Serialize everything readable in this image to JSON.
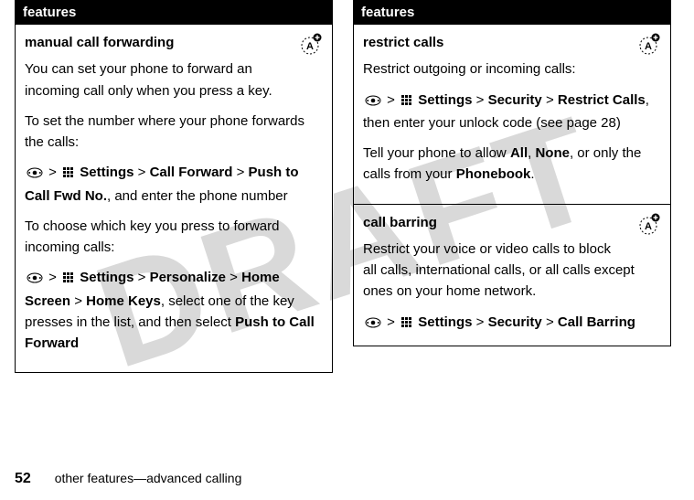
{
  "watermark": "DRAFT",
  "left": {
    "header": "features",
    "section": {
      "title": "manual call forwarding",
      "p1": "You can set your phone to forward an incoming call only when you press a key.",
      "p2": "To set the number where your phone forwards the calls:",
      "path1": {
        "sep": " > ",
        "s1": "Settings",
        "s2": "Call Forward",
        "s3": "Push to Call Fwd No.",
        "tail": ", and enter the phone number"
      },
      "p3": "To choose which key you press to forward incoming calls:",
      "path2": {
        "sep": " > ",
        "s1": "Settings",
        "s2": "Personalize",
        "s3": "Home Screen",
        "s4": "Home Keys",
        "tail1": ", select one of the key presses in the list, and then select ",
        "tail2": "Push to Call Forward"
      }
    }
  },
  "right": {
    "header": "features",
    "section1": {
      "title": "restrict calls",
      "p1": "Restrict outgoing or incoming calls:",
      "path": {
        "sep": " > ",
        "s1": "Settings",
        "s2": "Security",
        "s3": "Restrict Calls",
        "tail": ", then enter your unlock code (see page 28)"
      },
      "p2a": "Tell your phone to allow ",
      "opt1": "All",
      "comma": ", ",
      "opt2": "None",
      "p2b": ", or only the calls from your ",
      "opt3": "Phonebook",
      "dot": "."
    },
    "section2": {
      "title": "call barring",
      "p1": "Restrict your voice or video calls to block all calls, international calls, or all calls except ones on your home network.",
      "path": {
        "sep": " > ",
        "s1": "Settings",
        "s2": "Security",
        "s3": "Call Barring"
      }
    }
  },
  "footer": {
    "page": "52",
    "text": "other features—advanced calling"
  }
}
